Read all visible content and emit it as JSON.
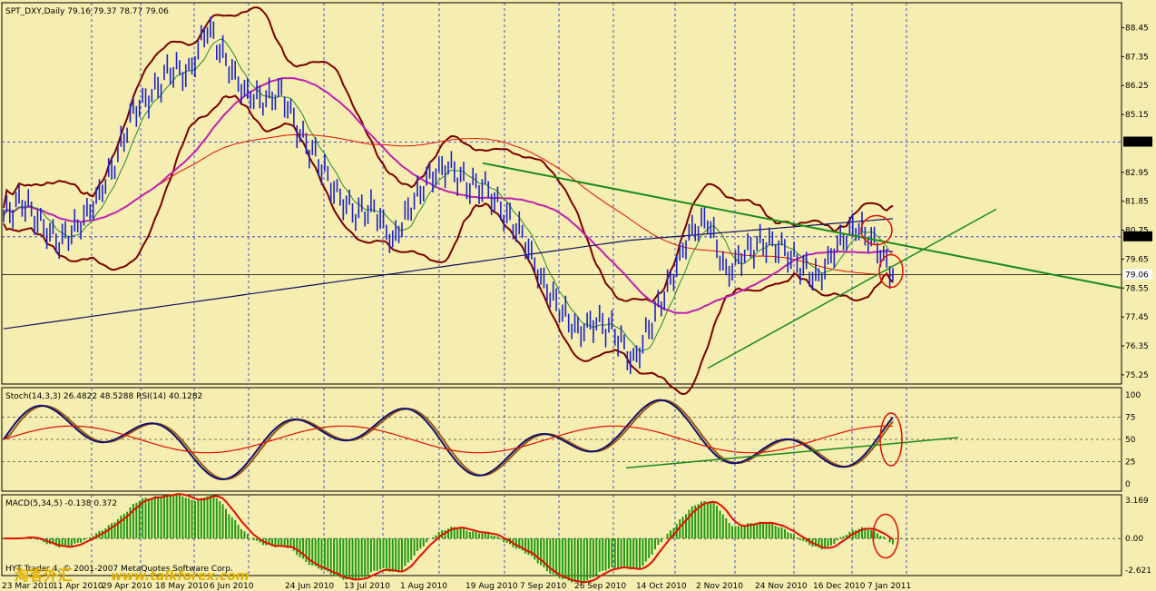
{
  "window_title": "SPT_DXY,Daily  79.16 79.37 78.77 79.06",
  "colors": {
    "background": "#f5eeb0",
    "grid": "#1a2ad8",
    "price_bars": "#1a22cc",
    "bollinger": "#7a0000",
    "ma_magenta": "#c020b0",
    "ma_red": "#e01000",
    "ma_blue_long": "#101060",
    "trendline": "#1a8a1a",
    "circle": "#e01000",
    "macd_hist": "#1e9a10",
    "macd_signal": "#e01000",
    "stoch_main": "#101070",
    "stoch_signal": "#9a5a10",
    "rsi": "#e01000"
  },
  "price_axis": {
    "ticks": [
      "88.45",
      "87.35",
      "86.25",
      "85.15",
      "84.10",
      "82.95",
      "81.85",
      "80.75",
      "80.50",
      "79.65",
      "79.06",
      "78.55",
      "77.45",
      "76.35",
      "75.25"
    ],
    "boxed": [
      "84.10",
      "80.50",
      "79.06"
    ]
  },
  "stoch_panel": {
    "label": "Stoch(14,3,3) 26.4822 48.5288  RSI(14) 40.1282",
    "ticks": [
      "100",
      "75",
      "50",
      "25",
      "0"
    ]
  },
  "macd_panel": {
    "label": "MACD(5,34,5) -0.138 0.372",
    "ticks": [
      "3.169",
      "0.00",
      "-2.621"
    ]
  },
  "copyright": "HYT Trader 4, © 2001-2007 MetaQuotes Software Corp.",
  "watermark": "www.talkforex.com",
  "watermark_cjk": "淘客外汇",
  "x_axis": {
    "labels": [
      "23 Mar 2010",
      "11 Apr 2010",
      "29 Apr 2010",
      "18 May 2010",
      "6 Jun 2010",
      "24 Jun 2010",
      "13 Jul 2010",
      "1 Aug 2010",
      "19 Aug 2010",
      "7 Sep 2010",
      "26 Sep 2010",
      "14 Oct 2010",
      "2 Nov 2010",
      "24 Nov 2010",
      "16 Dec 2010",
      "7 Jan 2011"
    ]
  },
  "chart_data": {
    "type": "line",
    "instrument": "SPT_DXY",
    "timeframe": "Daily",
    "ohlc_last": {
      "open": 79.16,
      "high": 79.37,
      "low": 78.77,
      "close": 79.06
    },
    "close_series": [
      {
        "date": "23 Mar 2010",
        "value": 81.3
      },
      {
        "date": "26 Mar 2010",
        "value": 81.9
      },
      {
        "date": "2 Apr 2010",
        "value": 81.0
      },
      {
        "date": "11 Apr 2010",
        "value": 80.3
      },
      {
        "date": "20 Apr 2010",
        "value": 80.9
      },
      {
        "date": "29 Apr 2010",
        "value": 81.9
      },
      {
        "date": "5 May 2010",
        "value": 83.3
      },
      {
        "date": "11 May 2010",
        "value": 85.3
      },
      {
        "date": "18 May 2010",
        "value": 85.9
      },
      {
        "date": "25 May 2010",
        "value": 86.9
      },
      {
        "date": "1 Jun 2010",
        "value": 86.7
      },
      {
        "date": "6 Jun 2010",
        "value": 88.5
      },
      {
        "date": "11 Jun 2010",
        "value": 87.2
      },
      {
        "date": "17 Jun 2010",
        "value": 86.0
      },
      {
        "date": "24 Jun 2010",
        "value": 85.7
      },
      {
        "date": "29 Jun 2010",
        "value": 86.0
      },
      {
        "date": "5 Jul 2010",
        "value": 84.4
      },
      {
        "date": "13 Jul 2010",
        "value": 83.4
      },
      {
        "date": "20 Jul 2010",
        "value": 82.1
      },
      {
        "date": "27 Jul 2010",
        "value": 81.4
      },
      {
        "date": "1 Aug 2010",
        "value": 81.6
      },
      {
        "date": "6 Aug 2010",
        "value": 80.3
      },
      {
        "date": "12 Aug 2010",
        "value": 81.7
      },
      {
        "date": "19 Aug 2010",
        "value": 82.8
      },
      {
        "date": "24 Aug 2010",
        "value": 83.2
      },
      {
        "date": "31 Aug 2010",
        "value": 82.5
      },
      {
        "date": "7 Sep 2010",
        "value": 82.4
      },
      {
        "date": "12 Sep 2010",
        "value": 81.4
      },
      {
        "date": "18 Sep 2010",
        "value": 80.6
      },
      {
        "date": "26 Sep 2010",
        "value": 78.9
      },
      {
        "date": "4 Oct 2010",
        "value": 77.8
      },
      {
        "date": "14 Oct 2010",
        "value": 76.9
      },
      {
        "date": "20 Oct 2010",
        "value": 77.3
      },
      {
        "date": "26 Oct 2010",
        "value": 76.9
      },
      {
        "date": "2 Nov 2010",
        "value": 75.7
      },
      {
        "date": "8 Nov 2010",
        "value": 77.3
      },
      {
        "date": "15 Nov 2010",
        "value": 78.8
      },
      {
        "date": "24 Nov 2010",
        "value": 80.6
      },
      {
        "date": "30 Nov 2010",
        "value": 81.2
      },
      {
        "date": "6 Dec 2010",
        "value": 79.1
      },
      {
        "date": "12 Dec 2010",
        "value": 79.9
      },
      {
        "date": "16 Dec 2010",
        "value": 80.3
      },
      {
        "date": "22 Dec 2010",
        "value": 80.1
      },
      {
        "date": "27 Dec 2010",
        "value": 79.4
      },
      {
        "date": "31 Dec 2010",
        "value": 78.9
      },
      {
        "date": "4 Jan 2011",
        "value": 80.2
      },
      {
        "date": "7 Jan 2011",
        "value": 80.9
      },
      {
        "date": "11 Jan 2011",
        "value": 80.3
      },
      {
        "date": "13 Jan 2011",
        "value": 79.06
      }
    ],
    "ylim": [
      74.9,
      89.4
    ],
    "grid": true,
    "stochastic": {
      "k": 26.4822,
      "d": 48.5288,
      "rsi": 40.1282,
      "ylim": [
        0,
        100
      ]
    },
    "macd": {
      "value": -0.138,
      "signal": 0.372,
      "ylim": [
        -2.621,
        3.169
      ]
    }
  }
}
